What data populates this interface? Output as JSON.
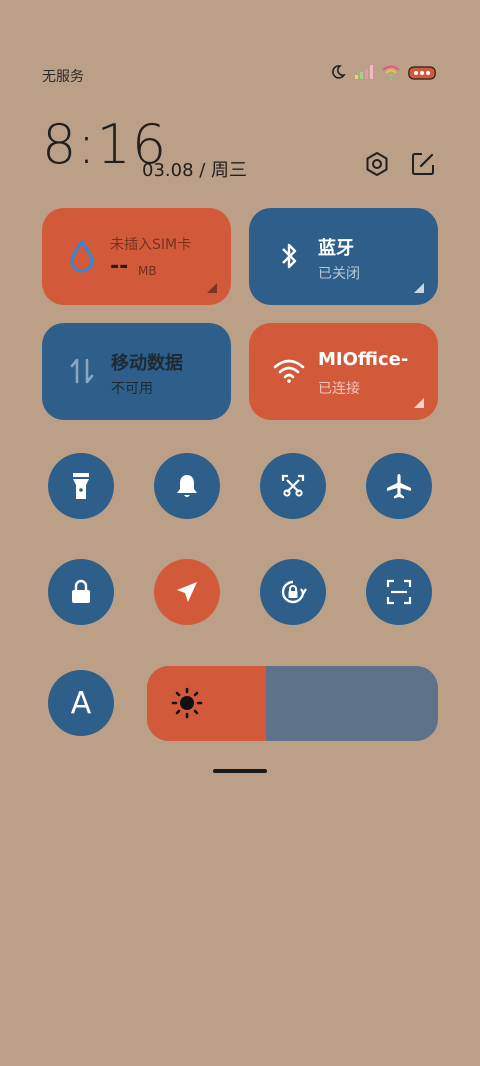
{
  "status": {
    "carrier": "无服务"
  },
  "header": {
    "time": "8:16",
    "date": "03.08 / 周三"
  },
  "tiles": {
    "data_usage": {
      "label": "未插入SIM卡",
      "value": "--",
      "unit": "MB"
    },
    "bluetooth": {
      "title": "蓝牙",
      "status": "已关闭"
    },
    "mobile_data": {
      "title": "移动数据",
      "status": "不可用"
    },
    "wifi": {
      "title": "MIOffice-",
      "status": "已连接"
    }
  },
  "toggles": [
    "flashlight-icon",
    "bell-icon",
    "screenshot-icon",
    "airplane-icon",
    "lock-icon",
    "location-icon",
    "rotation-lock-icon",
    "scan-icon"
  ],
  "auto_brightness": {
    "label": "A"
  },
  "brightness": {
    "level": 0.41
  },
  "colors": {
    "accent_orange": "#d25a3a",
    "tile_blue": "#2d5f8a",
    "background": "#bb9f87"
  }
}
